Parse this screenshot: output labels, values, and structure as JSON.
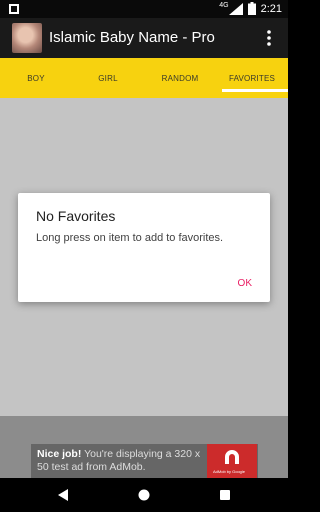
{
  "status_bar": {
    "network": "4G",
    "time": "2:21"
  },
  "app_bar": {
    "title": "Islamic Baby Name - Pro",
    "overflow_icon": "more-vert-icon"
  },
  "tabs": [
    {
      "label": "BOY",
      "active": false
    },
    {
      "label": "GIRL",
      "active": false
    },
    {
      "label": "RANDOM",
      "active": false
    },
    {
      "label": "FAVORITES",
      "active": true
    }
  ],
  "dialog": {
    "title": "No Favorites",
    "message": "Long press on item to add to favorites.",
    "ok_label": "OK"
  },
  "ad": {
    "bold_text": "Nice job!",
    "text": " You're displaying a 320 x 50 test ad from AdMob.",
    "logo_caption": "AdMob by Google"
  },
  "colors": {
    "tab_bar": "#f7d20f",
    "accent": "#e91e63",
    "app_bar": "#1a1a1a"
  }
}
